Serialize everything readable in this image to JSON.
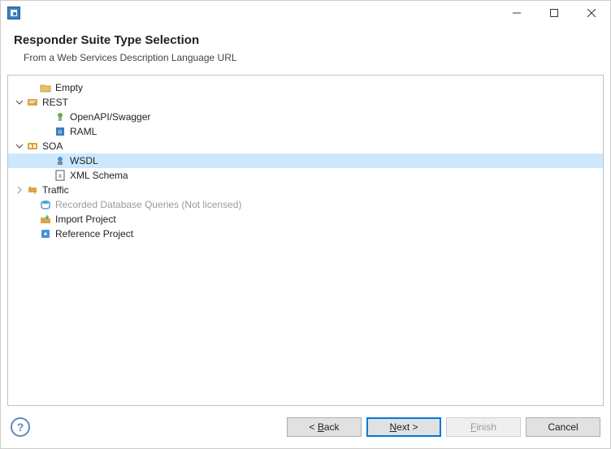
{
  "header": {
    "title": "Responder Suite Type Selection",
    "subtitle": "From a Web Services Description Language URL"
  },
  "tree": {
    "empty": "Empty",
    "rest": "REST",
    "swagger": "OpenAPI/Swagger",
    "raml": "RAML",
    "soa": "SOA",
    "wsdl": "WSDL",
    "xmlschema": "XML Schema",
    "traffic": "Traffic",
    "recordeddb": "Recorded Database Queries (Not licensed)",
    "import": "Import Project",
    "reference": "Reference Project"
  },
  "footer": {
    "back": "< Back",
    "next": "Next >",
    "finish": "Finish",
    "cancel": "Cancel"
  }
}
